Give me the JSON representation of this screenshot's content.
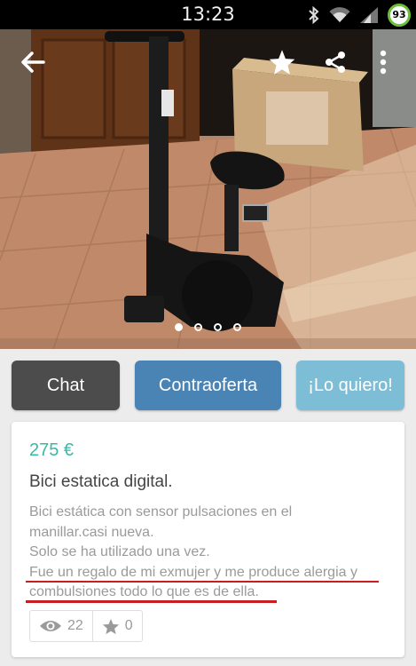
{
  "status_bar": {
    "time": "13:23",
    "battery": "93"
  },
  "toolbar": {
    "back_icon": "arrow-left-icon",
    "favorite_icon": "star-icon",
    "share_icon": "share-icon",
    "menu_icon": "more-vert-icon"
  },
  "gallery": {
    "photo_count": 4,
    "active_index": 0
  },
  "actions": {
    "chat_label": "Chat",
    "counteroffer_label": "Contraoferta",
    "buy_label": "¡Lo quiero!"
  },
  "item": {
    "price": "275 €",
    "title": "Bici estatica digital.",
    "description_lines": [
      "Bici estática con sensor pulsaciones en el",
      "manillar.casi nueva.",
      "Solo se ha utilizado una vez.",
      "Fue un regalo de mi exmujer y me produce alergia y",
      "combulsiones todo lo que es de ella."
    ],
    "views": "22",
    "favorites": "0"
  },
  "colors": {
    "chat_button": "#4c4c4c",
    "counteroffer_button": "#4a84b5",
    "buy_button": "#7ebdd6",
    "price_text": "#3ab7a5",
    "underline": "#c81e22"
  }
}
